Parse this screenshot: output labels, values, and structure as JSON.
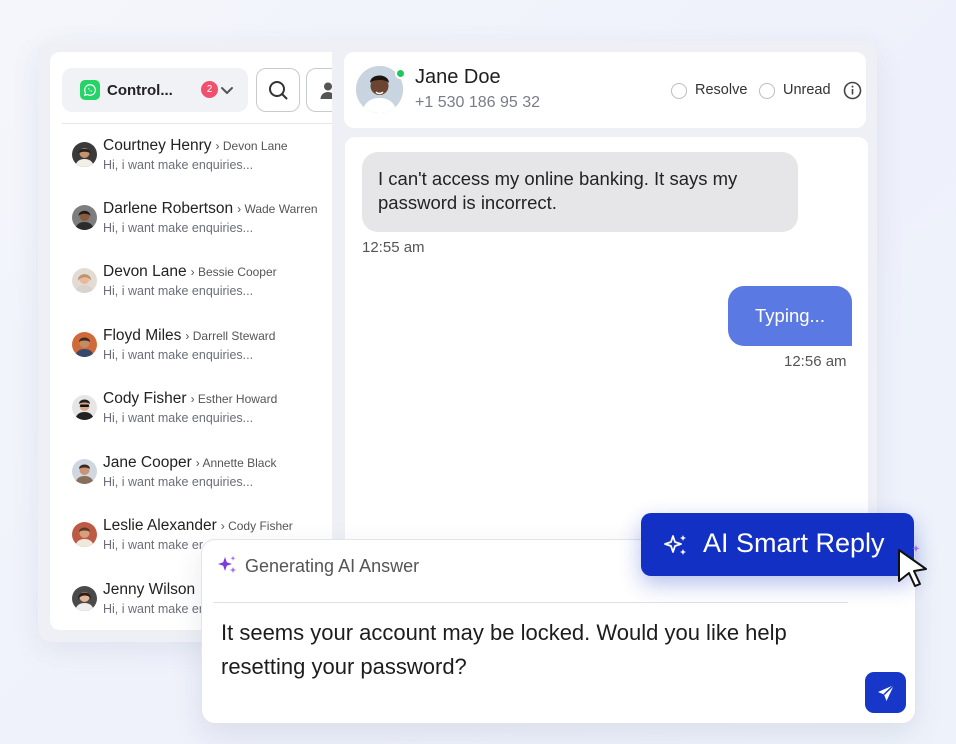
{
  "sidebar": {
    "channel": {
      "label": "Control...",
      "badge": "2",
      "icon": "whatsapp-icon"
    },
    "conversations": [
      {
        "name": "Courtney Henry",
        "assignee": "Devon Lane",
        "preview": "Hi, i want make enquiries..."
      },
      {
        "name": "Darlene Robertson",
        "assignee": "Wade Warren",
        "preview": "Hi, i want make enquiries..."
      },
      {
        "name": "Devon Lane",
        "assignee": "Bessie Cooper",
        "preview": "Hi, i want make enquiries..."
      },
      {
        "name": "Floyd Miles",
        "assignee": "Darrell Steward",
        "preview": "Hi, i want make enquiries..."
      },
      {
        "name": "Cody Fisher",
        "assignee": "Esther Howard",
        "preview": "Hi, i want make enquiries..."
      },
      {
        "name": "Jane Cooper",
        "assignee": "Annette Black",
        "preview": "Hi, i want make enquiries..."
      },
      {
        "name": "Leslie Alexander",
        "assignee": "Cody Fisher",
        "preview": "Hi, i want make er"
      },
      {
        "name": "Jenny Wilson",
        "assignee": "",
        "preview": "Hi, i want make er"
      }
    ]
  },
  "header": {
    "name": "Jane Doe",
    "phone": "+1 530 186 95 32",
    "resolve_label": "Resolve",
    "unread_label": "Unread"
  },
  "messages": {
    "incoming_text": "I can't access my online banking. It says my password is incorrect.",
    "incoming_time": "12:55 am",
    "outgoing_text": "Typing...",
    "outgoing_time": "12:56 am"
  },
  "composer": {
    "status_label": "Generating AI Answer",
    "reply_text": "It seems your account may be locked. Would you like help resetting your password?"
  },
  "ai_button": {
    "label": "AI Smart Reply"
  },
  "colors": {
    "accent": "#1230c4",
    "outgoing_bubble": "#5b79e2",
    "incoming_bubble": "#e6e6e8",
    "badge": "#f0506e",
    "online": "#22c55e",
    "whatsapp": "#25d366"
  }
}
